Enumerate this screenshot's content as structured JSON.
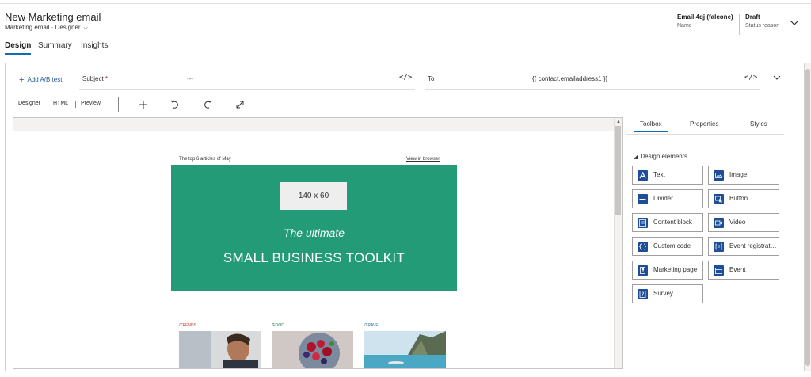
{
  "header": {
    "title": "New Marketing email",
    "subtitle": "Marketing email · Designer",
    "name_value": "Email 4qj (falcone)",
    "name_label": "Name",
    "status_value": "Draft",
    "status_label": "Status reason"
  },
  "tabs": [
    "Design",
    "Summary",
    "Insights"
  ],
  "fields": {
    "add_ab": "Add A/B test",
    "subject_label": "Subject",
    "subject_required": "*",
    "subject_value": "---",
    "to_label": "To",
    "to_value": "{{ contact.emailaddress1 }}",
    "code_icon": "</>"
  },
  "editor_tabs": [
    "Designer",
    "HTML",
    "Preview"
  ],
  "email": {
    "top_text": "The top 6 articles of May",
    "view_in_browser": "View in browser",
    "logo_placeholder": "140 x 60",
    "hero_line1": "The ultimate",
    "hero_line2": "SMALL BUSINESS TOOLKIT",
    "categories": [
      {
        "label": "/TRENDS",
        "color": "#c0392b"
      },
      {
        "label": "/FOOD",
        "color": "#1e8449"
      },
      {
        "label": "/TRAVEL",
        "color": "#2471a3"
      }
    ]
  },
  "sidepanel": {
    "tabs": [
      "Toolbox",
      "Properties",
      "Styles"
    ],
    "section_title": "Design elements",
    "elements": [
      {
        "label": "Text",
        "icon": "text-icon"
      },
      {
        "label": "Image",
        "icon": "image-icon"
      },
      {
        "label": "Divider",
        "icon": "divider-icon"
      },
      {
        "label": "Button",
        "icon": "button-icon"
      },
      {
        "label": "Content block",
        "icon": "content-block-icon"
      },
      {
        "label": "Video",
        "icon": "video-icon"
      },
      {
        "label": "Custom code",
        "icon": "custom-code-icon"
      },
      {
        "label": "Event registrati...",
        "icon": "event-registration-icon"
      },
      {
        "label": "Marketing page",
        "icon": "marketing-page-icon"
      },
      {
        "label": "Event",
        "icon": "event-icon"
      },
      {
        "label": "Survey",
        "icon": "survey-icon"
      }
    ]
  },
  "colors": {
    "hero_green": "#229b76",
    "accent_blue": "#0f6cbd",
    "icon_blue": "#1f4e99"
  }
}
